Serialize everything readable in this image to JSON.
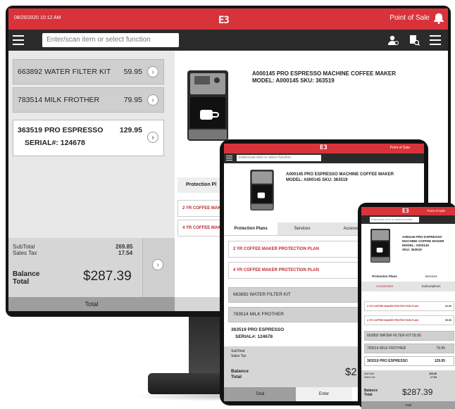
{
  "brand": {
    "logo": "E3"
  },
  "monitor": {
    "datetime": "08/20/2020 10:12 AM",
    "app_title": "Point of Sale",
    "search_placeholder": "Enter/scan item or select function",
    "line_items": [
      {
        "name": "663892 WATER FILTER KIT",
        "price": "59.95"
      },
      {
        "name": "783514 MILK FROTHER",
        "price": "79.95"
      },
      {
        "name": "363519 PRO ESPRESSO",
        "price": "129.95",
        "serial": "SERIAL#: 124678"
      }
    ],
    "subtotal_label": "SubTotal",
    "subtotal_value": "269.85",
    "tax_label": "Sales Tax",
    "tax_value": "17.54",
    "balance_label_1": "Balance",
    "balance_label_2": "Total",
    "balance_amount": "$287.39",
    "total_button": "Total",
    "product_title": "A000145 PRO ESPRESSO MACHINE COFFEE MAKER",
    "product_model_label": "MODEL:",
    "product_model": "A000145",
    "product_sku_label": "SKU:",
    "product_sku": "363519",
    "protection_tab": "Protection Pl",
    "plan_1": "2 YR COFFEE MAK",
    "plan_2": "4 YR COFFEE MAK"
  },
  "tablet": {
    "app_title": "Point of Sale",
    "search_placeholder": "Enter/scan item or select function",
    "product_title": "A000145 PRO ESPRESSO MACHINE COFFEE MAKER",
    "product_model_line": "MODEL: A000145",
    "product_sku_line": "SKU: 363519",
    "tabs": [
      "Protection Plans",
      "Services",
      "Accesso"
    ],
    "plans": [
      "2 YR COFFEE MAKER PROTECTION PLAN",
      "4 YR COFFEE MAKER PROTECTION PLAN"
    ],
    "items": [
      "663892 WATER FILTER KIT",
      "783514 MILK FROTHER"
    ],
    "sel_item": "363519 PRO ESPRESSO",
    "sel_serial": "SERIAL#: 124678",
    "subtotal_label": "SubTotal",
    "tax_label": "Sales Tax",
    "balance_label_1": "Balance",
    "balance_label_2": "Total",
    "balance_amount": "$2",
    "total_button": "Total",
    "enter_button": "Enter"
  },
  "phone": {
    "app_title": "Point of Sale",
    "search_placeholder": "Enter/scan item or select function",
    "product_title": "A000145 PRO ESPRESSO MACHINE COFFEE MAKER",
    "product_model_line": "MODEL: A000145",
    "product_sku_line": "SKU: 363519",
    "tabs_row1": [
      "Protection Plans",
      "Services"
    ],
    "tabs_row2": [
      "Accessories",
      "Subscriptions"
    ],
    "plans": [
      {
        "name": "2 YR COFFEE MAKER PROTECTION PLAN",
        "price": "32.99"
      },
      {
        "name": "4 YR COFFEE MAKER PROTECTION PLAN",
        "price": "59.99"
      }
    ],
    "items": [
      {
        "name": "663892 WATER FILTER KIT",
        "price": "59.95"
      },
      {
        "name": "783514 MILK FROTHER",
        "price": "79.95"
      },
      {
        "name": "363519 PRO ESPRESSO",
        "price": "129.95"
      }
    ],
    "subtotal_label": "SubTotal",
    "subtotal_value": "269.85",
    "tax_label": "Sales Tax",
    "tax_value": "17.54",
    "balance_label_1": "Balance",
    "balance_label_2": "Total",
    "balance_amount": "$287.39",
    "total_button": "Total"
  },
  "colors": {
    "accent": "#d8333a",
    "toolbar": "#2b2b2b"
  }
}
